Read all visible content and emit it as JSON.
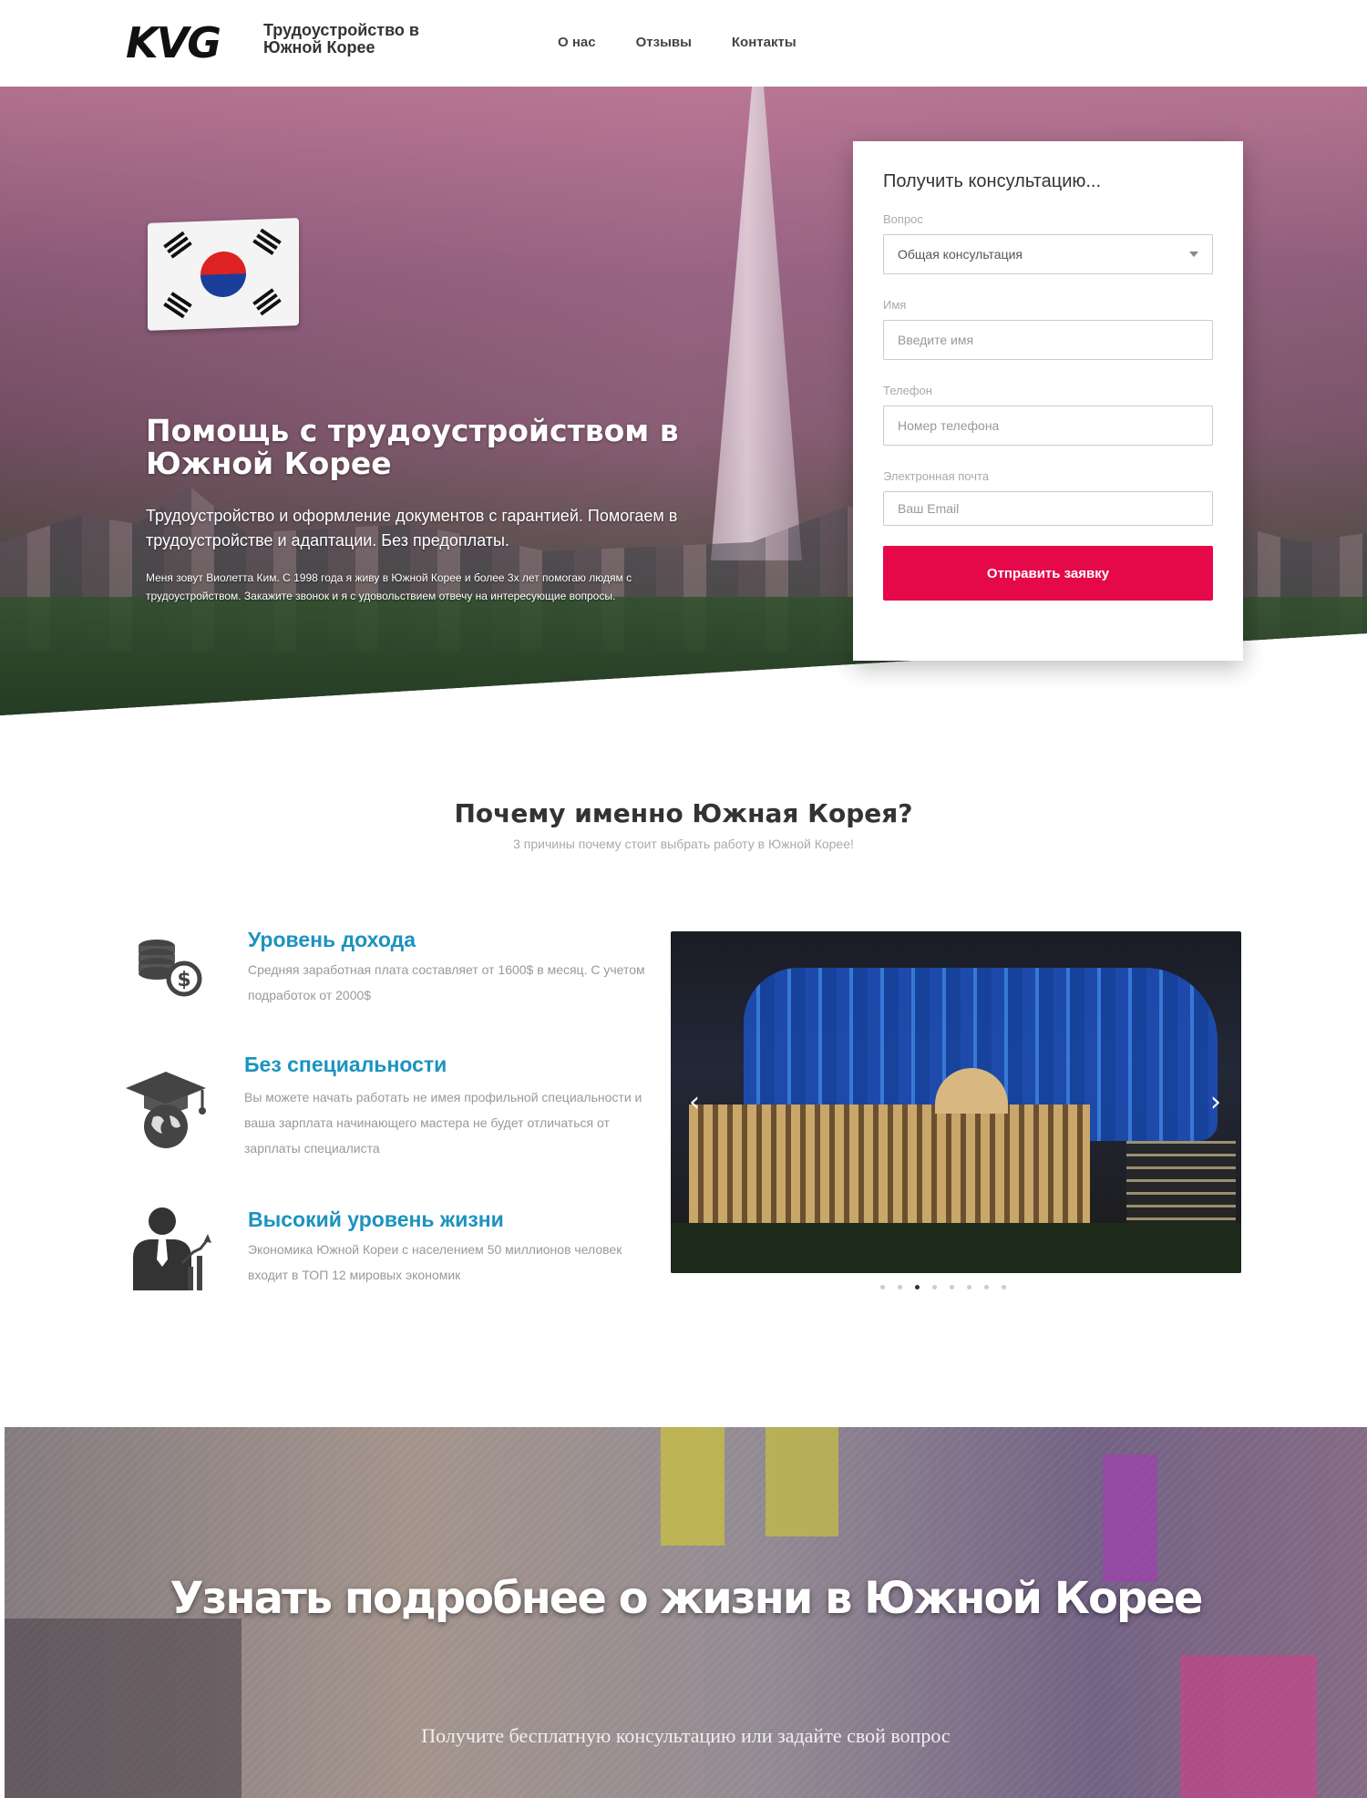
{
  "header": {
    "logo": "KVG",
    "subtitle": "Трудоустройство в Южной Корее",
    "nav": [
      "О нас",
      "Отзывы",
      "Контакты"
    ]
  },
  "hero": {
    "title": "Помощь с трудоустройством в Южной Корее",
    "lead": "Трудоустройство и оформление документов с гарантией. Помогаем в трудоустройстве и адаптации. Без предоплаты.",
    "small": "Меня зовут Виолетта Ким. С 1998 года я живу в Южной Корее и более 3х лет помогаю людям с трудоустройством. Закажите звонок и я с удовольствием отвечу на интересующие вопросы."
  },
  "form": {
    "title": "Получить консультацию...",
    "question_label": "Вопрос",
    "question_value": "Общая консультация",
    "name_label": "Имя",
    "name_placeholder": "Введите имя",
    "phone_label": "Телефон",
    "phone_placeholder": "Номер телефона",
    "email_label": "Электронная почта",
    "email_placeholder": "Ваш Email",
    "submit_label": "Отправить заявку"
  },
  "why": {
    "title": "Почему именно Южная Корея?",
    "subtitle": "3 причины почему стоит выбрать работу в Южной Корее!",
    "reasons": [
      {
        "title": "Уровень дохода",
        "text": "Средняя заработная плата составляет от 1600$ в месяц. С учетом подработок от 2000$",
        "icon": "coins-dollar-icon"
      },
      {
        "title": "Без специальности",
        "text": "Вы можете начать работать не имея профильной специальности и ваша зарплата начинающего мастера не будет отличаться от зарплаты специалиста",
        "icon": "graduation-globe-icon"
      },
      {
        "title": "Высокий уровень жизни",
        "text": "Экономика Южной Кореи с населением 50 миллионов человек входит в ТОП 12 мировых экономик",
        "icon": "businessman-growth-icon"
      }
    ]
  },
  "carousel": {
    "prev": "‹",
    "next": "›",
    "slide_count": 8,
    "active_slide": 3
  },
  "banner": {
    "title": "Узнать подробнее о жизни в Южной Корее",
    "subtitle": "Получите бесплатную консультацию или задайте свой вопрос"
  },
  "colors": {
    "accent": "#e5094a",
    "link_blue": "#1b93c0"
  }
}
